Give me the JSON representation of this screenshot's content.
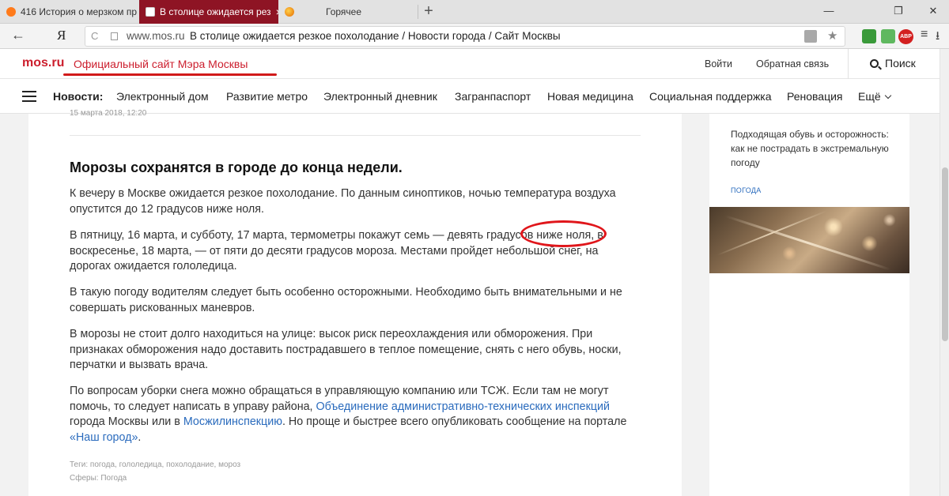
{
  "browser": {
    "tabs": [
      {
        "label": "416 История о мерзком пр"
      },
      {
        "label": "В столице ожидается рез",
        "close": "×"
      },
      {
        "label": "Горячее"
      }
    ],
    "new_tab": "+",
    "window_controls": {
      "minimize": "—",
      "restore": "❐",
      "close": "✕"
    },
    "back": "←",
    "browser_logo": "Я",
    "reload": "C",
    "url_domain": "www.mos.ru",
    "url_title": "В столице ожидается резкое похолодание / Новости города / Сайт Москвы",
    "star": "★",
    "extension_badge": "ABP",
    "menu": "≡",
    "download": "⭳"
  },
  "header": {
    "logo": "mos.ru",
    "mayor_link": "Официальный сайт Мэра Москвы",
    "login": "Войти",
    "feedback": "Обратная связь",
    "search": "Поиск"
  },
  "nav": {
    "title": "Новости:",
    "items": [
      {
        "label": "Электронный дом"
      },
      {
        "label": "Развитие метро"
      },
      {
        "label": "Электронный дневник"
      },
      {
        "label": "Загранпаспорт"
      },
      {
        "label": "Новая медицина"
      },
      {
        "label": "Социальная поддержка"
      },
      {
        "label": "Реновация"
      }
    ],
    "more": "Ещё"
  },
  "article": {
    "date": "15 марта 2018, 12:20",
    "headline": "Морозы сохранятся в городе до конца недели.",
    "paragraphs": [
      "К вечеру в Москве ожидается резкое похолодание. По данным синоптиков, ночью температура воздуха опустится до 12 градусов ниже ноля.",
      "В пятницу, 16 марта, и субботу, 17 марта, термометры покажут семь — девять градусов ниже ноля, в воскресенье, 18 марта, — от пяти до десяти градусов мороза. Местами пройдет небольшой снег, на дорогах ожидается гололедица.",
      "В такую погоду водителям следует быть особенно осторожными. Необходимо быть внимательными и не совершать рискованных маневров.",
      "В морозы не стоит долго находиться на улице: высок риск переохлаждения или обморожения. При признаках обморожения надо доставить пострадавшего в теплое помещение, снять с него обувь, носки, перчатки и вызвать врача."
    ],
    "last_paragraph": {
      "text1": "По вопросам уборки снега можно обращаться в управляющую компанию или ТСЖ. Если там не могут помочь, то следует написать в управу района, ",
      "link1": "Объединение административно-технических инспекций",
      "text2": " города Москвы или в ",
      "link2": "Мосжилинспекцию",
      "text3": ". Но проще и быстрее всего опубликовать сообщение на портале ",
      "link3": "«Наш город»",
      "text4": "."
    },
    "tags": "Теги: погода, гололедица, похолодание, мороз",
    "spheres": "Сферы: Погода"
  },
  "sidebar": {
    "title": "Подходящая обувь и осторожность: как не пострадать в экстремальную погоду",
    "tag": "ПОГОДА"
  }
}
